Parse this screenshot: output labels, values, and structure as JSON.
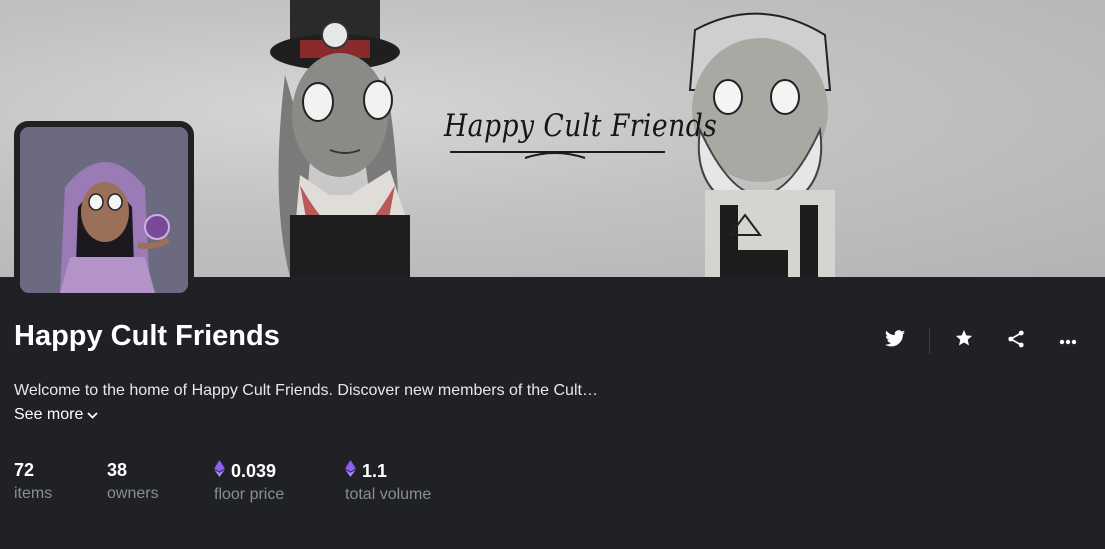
{
  "banner": {
    "title": "Happy Cult Friends"
  },
  "collection": {
    "name": "Happy Cult Friends",
    "description": "Welcome to the home of Happy Cult Friends. Discover new members of the Cult…",
    "see_more_label": "See more"
  },
  "actions": {
    "icons": [
      "twitter-icon",
      "star-icon",
      "share-icon",
      "more-icon"
    ]
  },
  "stats": [
    {
      "value": "72",
      "label": "items",
      "currency_icon": ""
    },
    {
      "value": "38",
      "label": "owners",
      "currency_icon": ""
    },
    {
      "value": "0.039",
      "label": "floor price",
      "currency_icon": "eth-icon"
    },
    {
      "value": "1.1",
      "label": "total volume",
      "currency_icon": "eth-icon"
    }
  ],
  "colors": {
    "background": "#202125",
    "muted_text": "#8a8d96",
    "eth_purple": "#8b5cf6"
  }
}
